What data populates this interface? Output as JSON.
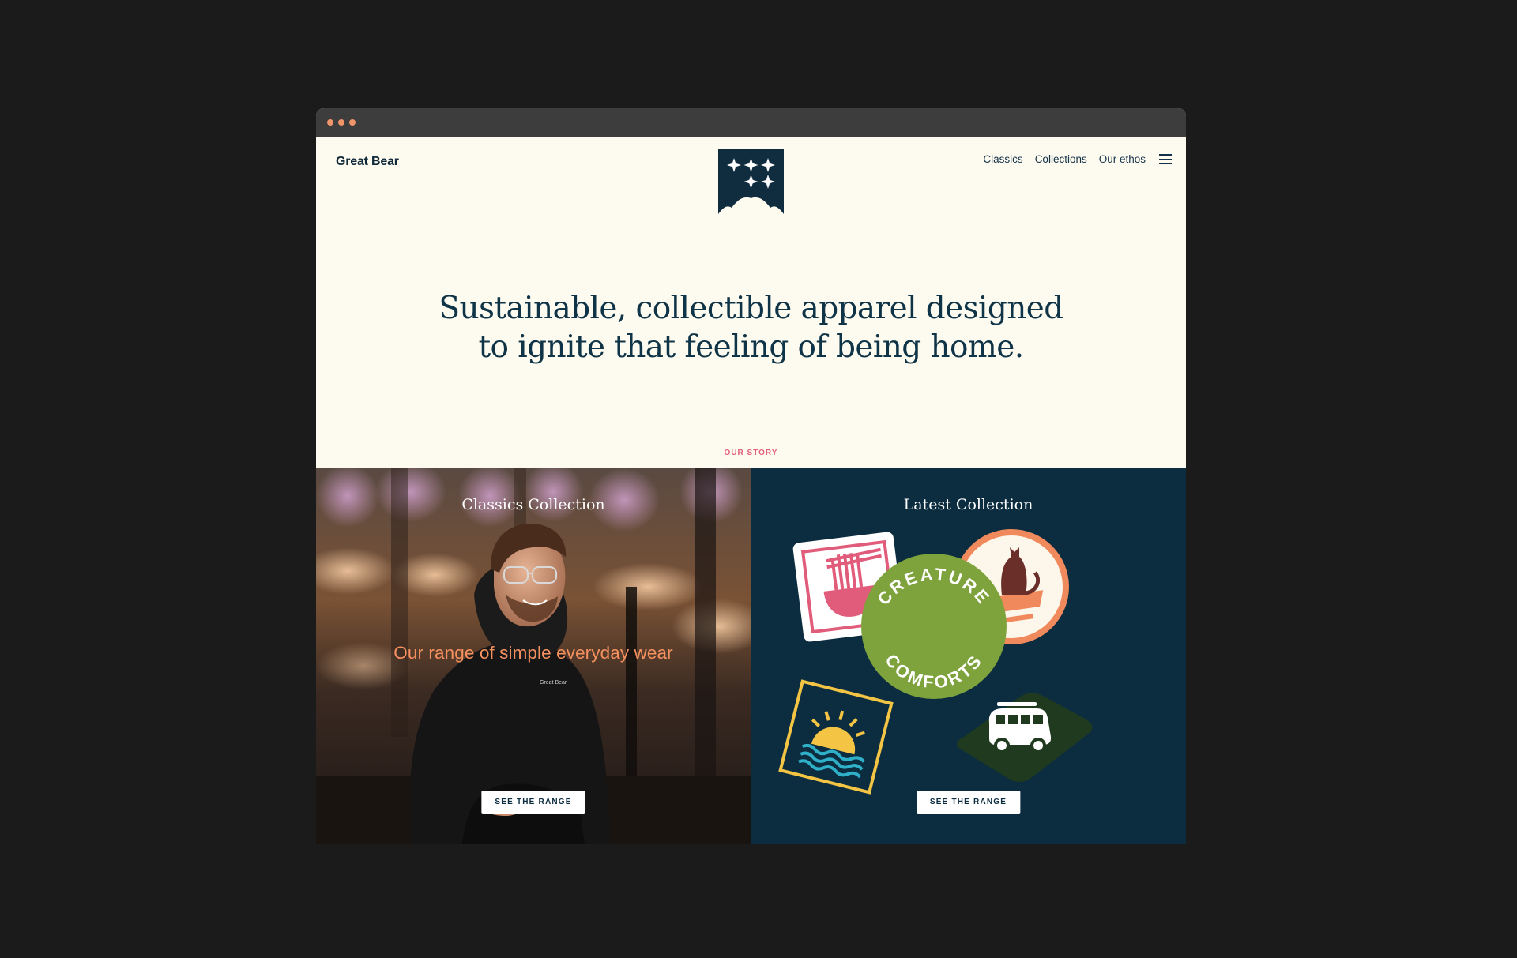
{
  "header": {
    "brand": "Great Bear",
    "nav": [
      "Classics",
      "Collections",
      "Our ethos"
    ]
  },
  "hero": {
    "headline_line1": "Sustainable, collectible apparel designed",
    "headline_line2": "to ignite that feeling of being home.",
    "cta": "OUR STORY"
  },
  "classics": {
    "title": "Classics Collection",
    "tagline": "Our range of simple everyday wear",
    "button": "SEE THE RANGE",
    "hoodie_print": "Great Bear"
  },
  "latest": {
    "title": "Latest Collection",
    "badge_word1": "CREATURE",
    "badge_word2": "COMFORTS",
    "button": "SEE THE RANGE"
  },
  "colors": {
    "background": "#1b1b1b",
    "cream": "#fdfbf0",
    "navy": "#0f3447",
    "coral": "#f5905f",
    "pink": "#e2607a",
    "green": "#7ea33d",
    "dark_green": "#203a1f"
  },
  "icons": [
    "menu-icon",
    "star-flag-logo",
    "noodle-bowl-icon",
    "cat-icon",
    "sunset-icon",
    "campervan-icon"
  ]
}
